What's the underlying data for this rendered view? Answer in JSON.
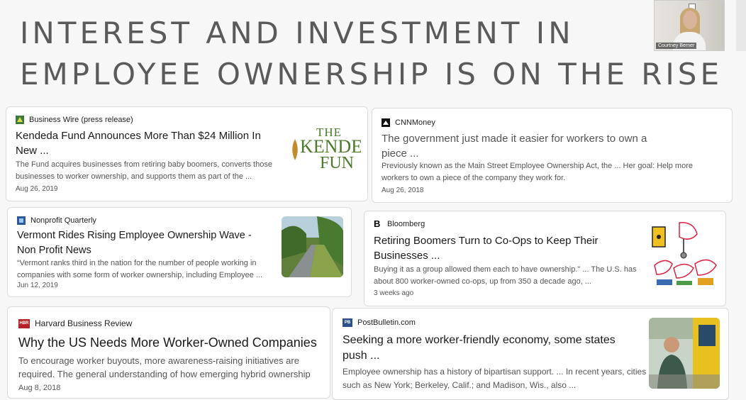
{
  "slide": {
    "title_line1": "INTEREST AND INVESTMENT IN",
    "title_line2": "EMPLOYEE OWNERSHIP IS ON THE RISE"
  },
  "video": {
    "participant_name": "Courtney Berner"
  },
  "cards": [
    {
      "source": "Business Wire (press release)",
      "headline": "Kendeda Fund Announces More Than $24 Million In New ...",
      "snippet": "The Fund acquires businesses from retiring baby boomers, converts those businesses to worker ownership, and supports them as part of the ...",
      "date": "Aug 26, 2019",
      "logo_line1": "THE",
      "logo_line2": "KENDE",
      "logo_line3": "FUN"
    },
    {
      "source": "CNNMoney",
      "headline": "The government just made it easier for workers to own a piece ...",
      "snippet": "Previously known as the Main Street Employee Ownership Act, the ... Her goal: Help more workers to own a piece of the company they work for.",
      "date": "Aug 26, 2018"
    },
    {
      "source": "Nonprofit Quarterly",
      "headline": "Vermont Rides Rising Employee Ownership Wave - Non Profit News",
      "snippet": "“Vermont ranks third in the nation for the number of people working in companies with some form of worker ownership, including Employee ...",
      "date": "Jun 12, 2019"
    },
    {
      "source": "Bloomberg",
      "headline": "Retiring Boomers Turn to Co-Ops to Keep Their Businesses ...",
      "snippet": "Buying it as a group allowed them each to have ownership.\" ... The U.S. has about 800 worker-owned co-ops, up from 350 a decade ago, ...",
      "date": "3 weeks ago"
    },
    {
      "source": "Harvard Business Review",
      "headline": "Why the US Needs More Worker-Owned Companies",
      "snippet": "To encourage worker buyouts, more awareness-raising initiatives are required. The general understanding of how emerging hybrid ownership",
      "date": "Aug 8, 2018",
      "favicon_text": "HBR"
    },
    {
      "source": "PostBulletin.com",
      "headline": "Seeking a more worker-friendly economy, some states push ...",
      "snippet": "Employee ownership has a history of bipartisan support. ... In recent years, cities such as New York; Berkeley, Calif.; and Madison, Wis., also ...",
      "date": "",
      "favicon_text": "PB"
    }
  ],
  "colors": {
    "title": "#5a5a5a",
    "kendeda_green": "#4a7a2a",
    "hbr_red": "#b52025",
    "pb_blue": "#2a4f8a"
  }
}
